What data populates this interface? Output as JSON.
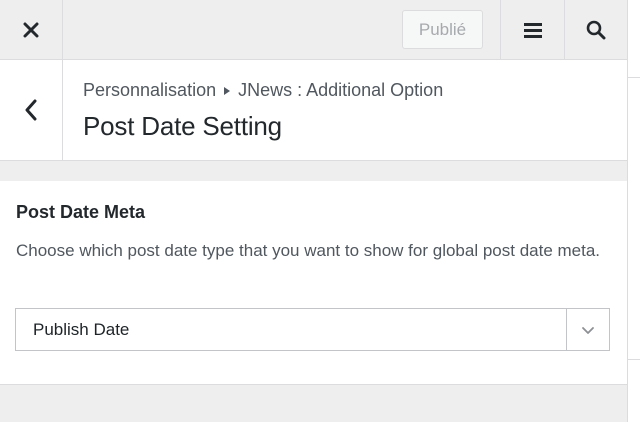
{
  "header": {
    "close_icon": "close-icon",
    "publish_label": "Publié",
    "menu_icon": "hamburger-menu-icon",
    "search_icon": "search-icon"
  },
  "section": {
    "back_icon": "chevron-left-icon",
    "breadcrumb": {
      "root": "Personnalisation",
      "current": "JNews : Additional Option"
    },
    "title": "Post Date Setting"
  },
  "control": {
    "title": "Post Date Meta",
    "description": "Choose which post date type that you want to show for global post date meta.",
    "select": {
      "value": "Publish Date",
      "arrow_icon": "chevron-down-icon"
    }
  },
  "colors": {
    "background": "#eeeeee",
    "surface": "#ffffff",
    "border": "#dcdcde",
    "text": "#23282d",
    "muted_text": "#50575e",
    "disabled_text": "#a7aaad"
  }
}
